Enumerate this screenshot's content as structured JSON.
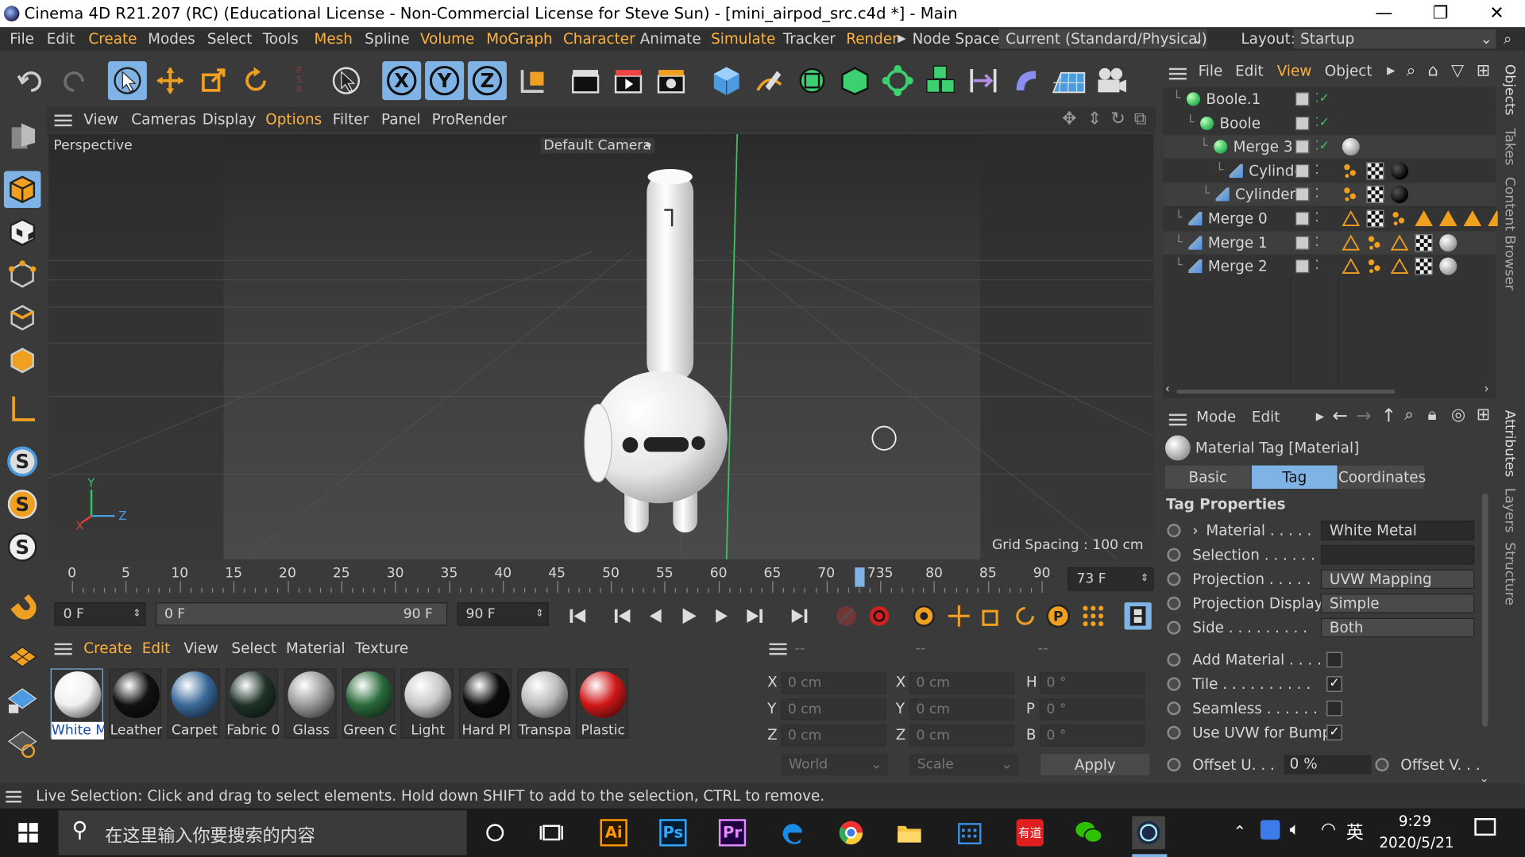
{
  "title": "Cinema 4D R21.207 (RC) (Educational License - Non-Commercial License for Steve Sun) - [mini_airpod_src.c4d *] - Main",
  "window_controls": {
    "minimize": "—",
    "maximize": "❐",
    "close": "✕"
  },
  "menu": {
    "items": [
      "File",
      "Edit",
      "Create",
      "Modes",
      "Select",
      "Tools",
      "Mesh",
      "Spline",
      "Volume",
      "MoGraph",
      "Character",
      "Animate",
      "Simulate",
      "Tracker",
      "Render"
    ],
    "node_space_label": "Node Space:",
    "node_space_value": "Current (Standard/Physical)",
    "layout_label": "Layout:",
    "layout_value": "Startup"
  },
  "toolbar": {
    "axis_x": "X",
    "axis_y": "Y",
    "axis_z": "Z"
  },
  "viewport": {
    "menu": [
      "View",
      "Cameras",
      "Display",
      "Options",
      "Filter",
      "Panel",
      "ProRender"
    ],
    "label": "Perspective",
    "camera": "Default Camera",
    "grid_spacing": "Grid Spacing : 100 cm",
    "axis": {
      "y": "Y",
      "z": "Z",
      "x": "X"
    }
  },
  "timeline": {
    "ticks": [
      "0",
      "5",
      "10",
      "15",
      "20",
      "25",
      "30",
      "35",
      "40",
      "45",
      "50",
      "55",
      "60",
      "65",
      "70",
      "735",
      "80",
      "85",
      "90"
    ],
    "current_frame": "73 F",
    "start": "0 F",
    "range_start": "0 F",
    "range_end": "90 F",
    "end": "90 F"
  },
  "materials": {
    "menu": [
      "Create",
      "Edit",
      "View",
      "Select",
      "Material",
      "Texture"
    ],
    "items": [
      {
        "label": "White M",
        "color": "#f0f0f0"
      },
      {
        "label": "Leather",
        "color": "#111111"
      },
      {
        "label": "Carpet",
        "color": "#3a6a9a"
      },
      {
        "label": "Fabric 0",
        "color": "#1f3328"
      },
      {
        "label": "Glass",
        "color": "#9a9a9a"
      },
      {
        "label": "Green G",
        "color": "#2a6a3a"
      },
      {
        "label": "Light",
        "color": "#c8c8c8"
      },
      {
        "label": "Hard Pl",
        "color": "#0c0c0c"
      },
      {
        "label": "Transpa",
        "color": "#bbbbbb"
      },
      {
        "label": "Plastic",
        "color": "#d01818"
      }
    ]
  },
  "coords": {
    "headers": [
      "--",
      "--",
      "--"
    ],
    "rows": [
      {
        "a": "X",
        "av": "0 cm",
        "b": "X",
        "bv": "0 cm",
        "c": "H",
        "cv": "0 °"
      },
      {
        "a": "Y",
        "av": "0 cm",
        "b": "Y",
        "bv": "0 cm",
        "c": "P",
        "cv": "0 °"
      },
      {
        "a": "Z",
        "av": "0 cm",
        "b": "Z",
        "bv": "0 cm",
        "c": "B",
        "cv": "0 °"
      }
    ],
    "world": "World",
    "scale": "Scale",
    "apply": "Apply"
  },
  "objects": {
    "menu": [
      "File",
      "Edit",
      "View",
      "Object"
    ],
    "items": [
      {
        "name": "Boole.1"
      },
      {
        "name": "Boole"
      },
      {
        "name": "Merge 3"
      },
      {
        "name": "Cylinder"
      },
      {
        "name": "Cylinder"
      },
      {
        "name": "Merge 0"
      },
      {
        "name": "Merge 1"
      },
      {
        "name": "Merge 2"
      }
    ]
  },
  "attributes": {
    "menu": [
      "Mode",
      "Edit"
    ],
    "header": "Material Tag [Material]",
    "tabs": [
      "Basic",
      "Tag",
      "Coordinates"
    ],
    "section": "Tag Properties",
    "props": [
      {
        "label": "Material . . . . .",
        "value": "White Metal"
      },
      {
        "label": "Selection . . . . . .",
        "value": ""
      },
      {
        "label": "Projection . . . . .",
        "value": "UVW Mapping"
      },
      {
        "label": "Projection Display",
        "value": "Simple"
      },
      {
        "label": "Side . . . . . . . . .",
        "value": "Both"
      }
    ],
    "checks": [
      {
        "label": "Add Material . . . .",
        "checked": false
      },
      {
        "label": "Tile . . . . . . . . . .",
        "checked": true
      },
      {
        "label": "Seamless . . . . . .",
        "checked": false
      },
      {
        "label": "Use UVW for Bump",
        "checked": true
      }
    ],
    "offset_u_label": "Offset U. . .",
    "offset_u_value": "0 %",
    "offset_v_label": "Offset V. . ."
  },
  "side_tabs": [
    "Objects",
    "Takes",
    "Content Browser",
    "Attributes",
    "Layers",
    "Structure"
  ],
  "status": "Live Selection: Click and drag to select elements. Hold down SHIFT to add to the selection, CTRL to remove.",
  "taskbar": {
    "search_placeholder": "在这里输入你要搜索的内容",
    "apps": [
      "Ai",
      "Ps",
      "Pr"
    ],
    "ime": "英",
    "time": "9:29",
    "date": "2020/5/21"
  }
}
